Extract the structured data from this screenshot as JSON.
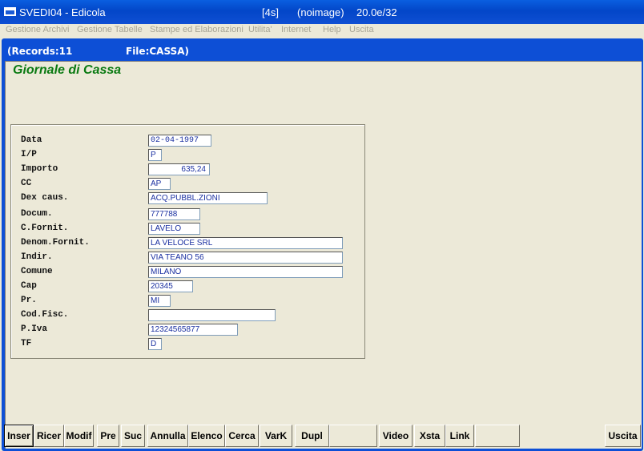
{
  "window": {
    "title": "SVEDI04 - Edicola",
    "mode": "[4s]",
    "image_status": "(noimage)",
    "version": "20.0e/32"
  },
  "menu": [
    "Gestione Archivi",
    "Gestione Tabelle",
    "Stampe ed Elaborazioni",
    "Utilita'",
    "Internet",
    "Help",
    "Uscita"
  ],
  "status": {
    "records": "(Records:11",
    "file": "File:CASSA)"
  },
  "form": {
    "heading": "Giornale di Cassa",
    "fields": [
      {
        "label": "Data",
        "value": "02-04-1997"
      },
      {
        "label": "I/P",
        "value": "P"
      },
      {
        "label": "Importo",
        "value": "635,24"
      },
      {
        "label": "CC",
        "value": "AP"
      },
      {
        "label": "Dex caus.",
        "value": "ACQ.PUBBL.ZIONI"
      },
      {
        "label": "Docum.",
        "value": "777788"
      },
      {
        "label": "C.Fornit.",
        "value": "LAVELO"
      },
      {
        "label": "Denom.Fornit.",
        "value": "LA VELOCE SRL"
      },
      {
        "label": "Indir.",
        "value": "VIA TEANO 56"
      },
      {
        "label": "Comune",
        "value": "MILANO"
      },
      {
        "label": "Cap",
        "value": "20345"
      },
      {
        "label": "Pr.",
        "value": "MI"
      },
      {
        "label": "Cod.Fisc.",
        "value": ""
      },
      {
        "label": "P.Iva",
        "value": "12324565877"
      },
      {
        "label": "TF",
        "value": "D"
      }
    ]
  },
  "toolbar": [
    "Inser",
    "Ricer",
    "Modif",
    "Pre",
    "Suc",
    "Annulla",
    "Elenco",
    "Cerca",
    "VarK",
    "Dupl",
    "",
    "Video",
    "Xsta",
    "Link",
    "",
    "Uscita"
  ]
}
